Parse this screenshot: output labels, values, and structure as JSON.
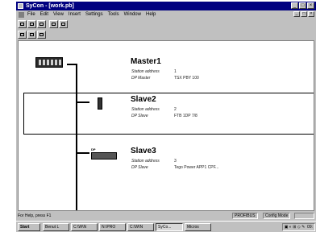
{
  "side_id": "562014",
  "window": {
    "title": "SyCon - [work.pb]"
  },
  "menu": {
    "items": [
      "File",
      "Edit",
      "View",
      "Insert",
      "Settings",
      "Tools",
      "Window",
      "Help"
    ]
  },
  "devices": [
    {
      "name": "Master1",
      "rows": [
        {
          "label": "Station address",
          "value": "1"
        },
        {
          "label": "DP Master",
          "value": "TSX PBY 100"
        }
      ]
    },
    {
      "name": "Slave2",
      "rows": [
        {
          "label": "Station address",
          "value": "2"
        },
        {
          "label": "DP Slave",
          "value": "FTB 1DP 7/8"
        }
      ]
    },
    {
      "name": "Slave3",
      "rows": [
        {
          "label": "Station address",
          "value": "3"
        },
        {
          "label": "DP Slave",
          "value": "Tego Power APP1 CPF..."
        }
      ]
    }
  ],
  "slave3_icon_label": "DP",
  "status": {
    "help": "For Help, press F1",
    "network": "PROFIBUS",
    "mode": "Config Mode"
  },
  "taskbar": {
    "start": "Start",
    "items": [
      "Benut L",
      "C:\\W\\N",
      "N:\\PRO",
      "C:\\W\\N",
      "SyCo...",
      "Micros"
    ],
    "clock": "09:"
  }
}
